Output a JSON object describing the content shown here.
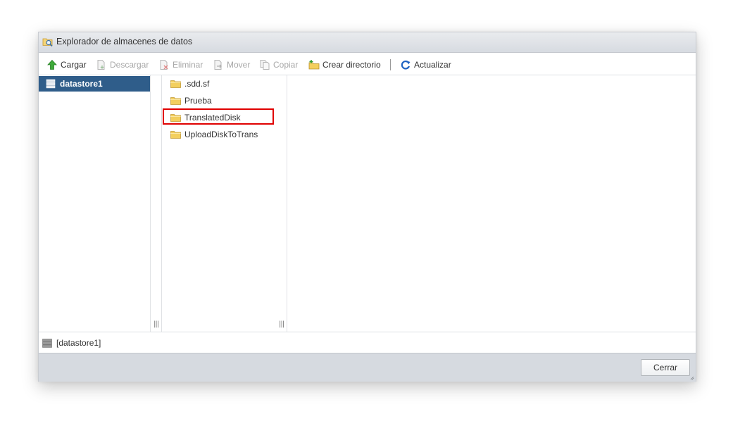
{
  "window": {
    "title": "Explorador de almacenes de datos"
  },
  "toolbar": {
    "items": [
      {
        "label": "Cargar",
        "icon": "upload-arrow-icon",
        "enabled": true
      },
      {
        "label": "Descargar",
        "icon": "download-file-icon",
        "enabled": false
      },
      {
        "label": "Eliminar",
        "icon": "delete-file-icon",
        "enabled": false
      },
      {
        "label": "Mover",
        "icon": "move-file-icon",
        "enabled": false
      },
      {
        "label": "Copiar",
        "icon": "copy-file-icon",
        "enabled": false
      },
      {
        "label": "Crear directorio",
        "icon": "new-folder-icon",
        "enabled": true
      },
      {
        "label": "Actualizar",
        "icon": "refresh-icon",
        "enabled": true
      }
    ]
  },
  "datastores": [
    {
      "label": "datastore1",
      "selected": true
    }
  ],
  "folders": [
    {
      "label": ".sdd.sf"
    },
    {
      "label": "Prueba"
    },
    {
      "label": "TranslatedDisk",
      "highlighted": true
    },
    {
      "label": "UploadDiskToTrans"
    }
  ],
  "status": {
    "path": "[datastore1]"
  },
  "footer": {
    "close_label": "Cerrar"
  },
  "colors": {
    "selected_bg": "#2f5d8a",
    "highlight_border": "#e00000",
    "footer_bg": "#d6dae0",
    "folder_yellow": "#f3cf5e"
  }
}
